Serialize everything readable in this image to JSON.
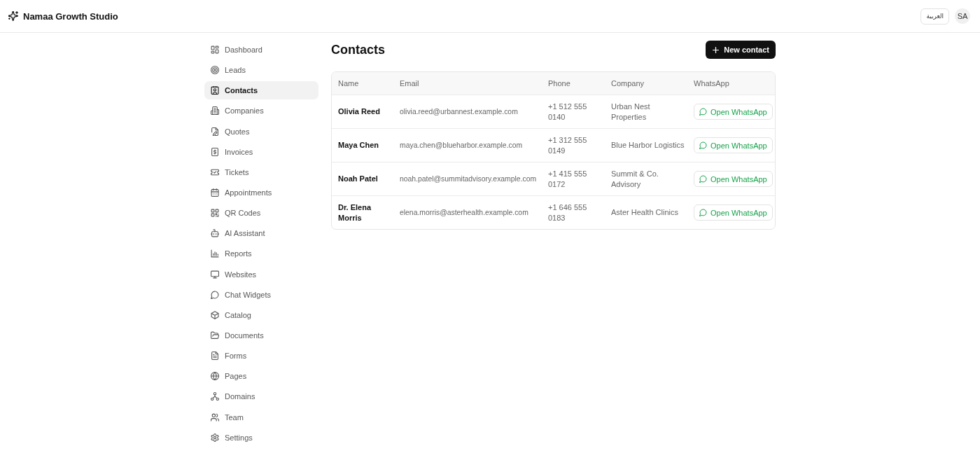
{
  "app": {
    "name": "Namaa Growth Studio"
  },
  "header": {
    "language_button": "العربية",
    "avatar": "SA"
  },
  "sidebar": {
    "items": [
      {
        "label": "Dashboard",
        "selected": false
      },
      {
        "label": "Leads",
        "selected": false
      },
      {
        "label": "Contacts",
        "selected": true
      },
      {
        "label": "Companies",
        "selected": false
      },
      {
        "label": "Quotes",
        "selected": false
      },
      {
        "label": "Invoices",
        "selected": false
      },
      {
        "label": "Tickets",
        "selected": false
      },
      {
        "label": "Appointments",
        "selected": false
      },
      {
        "label": "QR Codes",
        "selected": false
      },
      {
        "label": "AI Assistant",
        "selected": false
      },
      {
        "label": "Reports",
        "selected": false
      },
      {
        "label": "Websites",
        "selected": false
      },
      {
        "label": "Chat Widgets",
        "selected": false
      },
      {
        "label": "Catalog",
        "selected": false
      },
      {
        "label": "Documents",
        "selected": false
      },
      {
        "label": "Forms",
        "selected": false
      },
      {
        "label": "Pages",
        "selected": false
      },
      {
        "label": "Domains",
        "selected": false
      },
      {
        "label": "Team",
        "selected": false
      },
      {
        "label": "Settings",
        "selected": false
      }
    ]
  },
  "page": {
    "title": "Contacts",
    "new_button": "New contact"
  },
  "table": {
    "columns": [
      "Name",
      "Email",
      "Phone",
      "Company",
      "WhatsApp"
    ],
    "rows": [
      {
        "name": "Olivia Reed",
        "email": "olivia.reed@urbannest.example.com",
        "phone": "+1 512 555 0140",
        "company": "Urban Nest Properties",
        "action": "Open WhatsApp"
      },
      {
        "name": "Maya Chen",
        "email": "maya.chen@blueharbor.example.com",
        "phone": "+1 312 555 0149",
        "company": "Blue Harbor Logistics",
        "action": "Open WhatsApp"
      },
      {
        "name": "Noah Patel",
        "email": "noah.patel@summitadvisory.example.com",
        "phone": "+1 415 555 0172",
        "company": "Summit & Co. Advisory",
        "action": "Open WhatsApp"
      },
      {
        "name": "Dr. Elena Morris",
        "email": "elena.morris@asterhealth.example.com",
        "phone": "+1 646 555 0183",
        "company": "Aster Health Clinics",
        "action": "Open WhatsApp"
      }
    ]
  }
}
